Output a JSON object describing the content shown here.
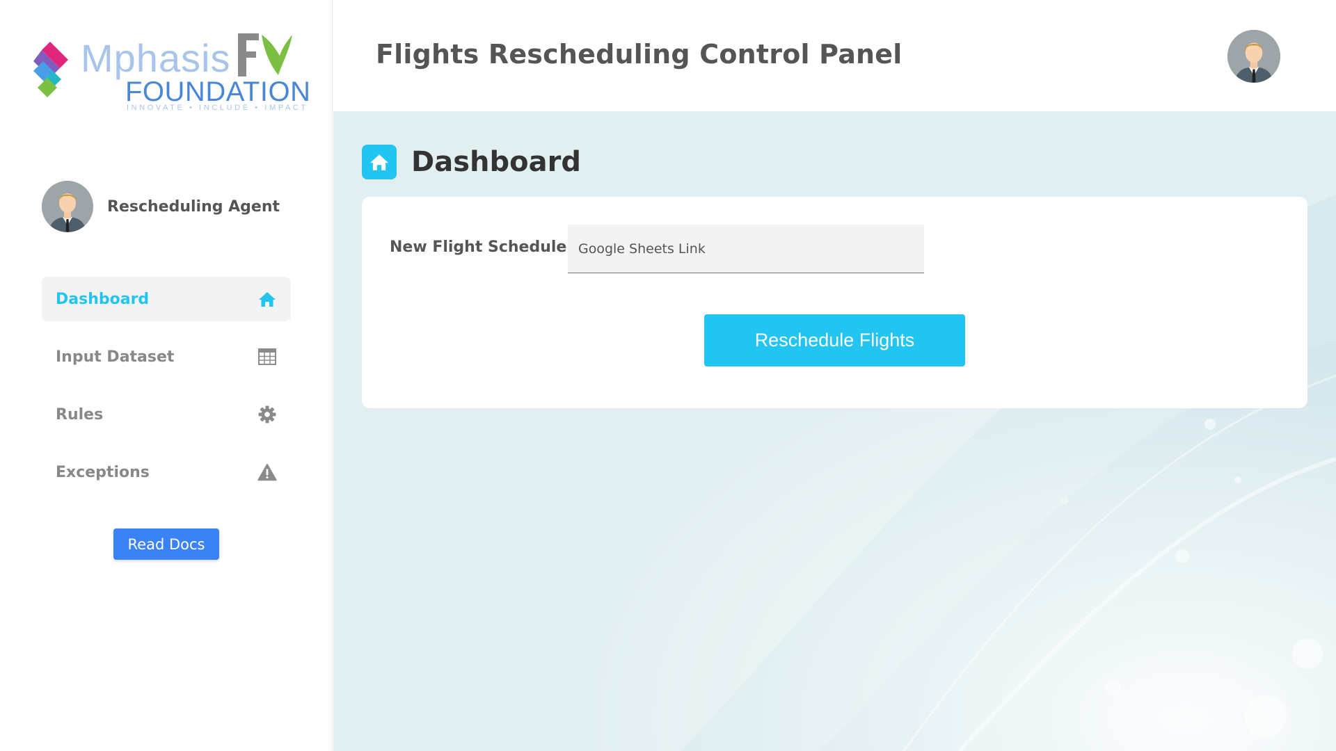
{
  "brand": {
    "name_line1": "Mphasis",
    "name_line2": "FOUNDATION",
    "tagline": "INNOVATE • INCLUDE • IMPACT",
    "colors": {
      "light_blue": "#a8c4ea",
      "blue": "#4a86d8",
      "pink": "#e0257a",
      "green": "#7bc043"
    }
  },
  "header": {
    "title": "Flights Rescheduling Control Panel"
  },
  "sidebar": {
    "profile_name": "Rescheduling Agent",
    "items": [
      {
        "label": "Dashboard",
        "icon": "home-icon",
        "active": true
      },
      {
        "label": "Input Dataset",
        "icon": "table-icon",
        "active": false
      },
      {
        "label": "Rules",
        "icon": "gear-icon",
        "active": false
      },
      {
        "label": "Exceptions",
        "icon": "warning-icon",
        "active": false
      }
    ],
    "read_docs_label": "Read Docs"
  },
  "main": {
    "section_title": "Dashboard",
    "section_icon": "home-icon",
    "form": {
      "field_label": "New Flight Schedule",
      "field_placeholder": "Google Sheets Link",
      "field_value": "",
      "submit_label": "Reschedule Flights"
    }
  },
  "colors": {
    "accent": "#22c4f1",
    "docs_button": "#3b82f6",
    "main_background": "#e2eff1"
  }
}
